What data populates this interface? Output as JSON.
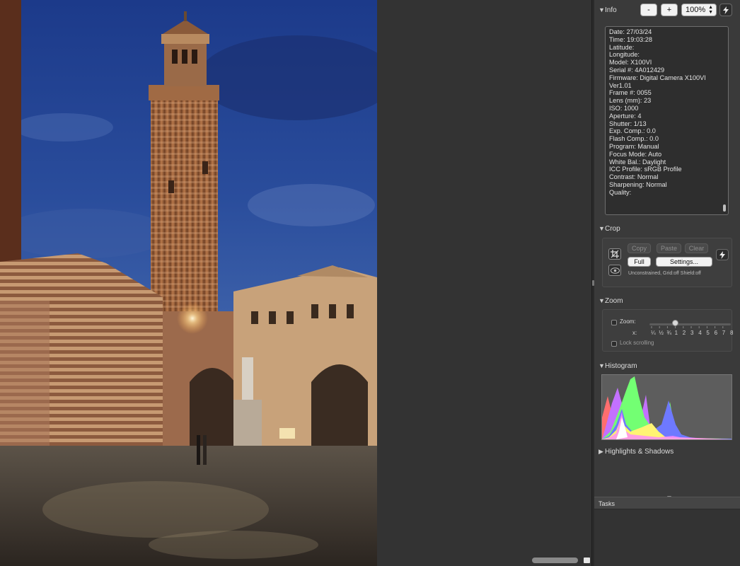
{
  "info": {
    "title": "Info",
    "zoom_out_label": "-",
    "zoom_in_label": "+",
    "zoom_level": "100%",
    "lines": [
      "Date: 27/03/24",
      "Time: 19:03:28",
      "Latitude:",
      "Longitude:",
      "Model: X100VI",
      "Serial #: 4A012429",
      "Firmware: Digital Camera X100VI",
      "Ver1.01",
      "Frame #: 0055",
      "Lens (mm): 23",
      "ISO: 1000",
      "Aperture: 4",
      "Shutter: 1/13",
      "Exp. Comp.: 0.0",
      "Flash Comp.: 0.0",
      "Program: Manual",
      "Focus Mode: Auto",
      "White Bal.: Daylight",
      "ICC Profile: sRGB Profile",
      "Contrast: Normal",
      "Sharpening: Normal",
      "Quality:"
    ]
  },
  "crop": {
    "title": "Crop",
    "copy_label": "Copy",
    "paste_label": "Paste",
    "clear_label": "Clear",
    "full_label": "Full",
    "settings_label": "Settings...",
    "status": "Unconstrained, Grid:off Shield:off"
  },
  "zoom": {
    "title": "Zoom",
    "zoom_label": "Zoom:",
    "x_label": "x:",
    "scale": [
      "¼",
      "½",
      "¾",
      "1",
      "2",
      "3",
      "4",
      "5",
      "6",
      "7",
      "8"
    ],
    "selected_index": 3,
    "lock_label": "Lock scrolling"
  },
  "histogram": {
    "title": "Histogram"
  },
  "highlights": {
    "title": "Highlights & Shadows"
  },
  "tasks": {
    "title": "Tasks"
  },
  "icons": {
    "collapse": "triangle-down-icon",
    "expand": "triangle-right-icon",
    "auto": "lightning-icon",
    "crop": "crop-icon",
    "view": "eye-icon"
  },
  "colors": {
    "panel_bg": "#3a3a3a",
    "viewer_bg": "#333333",
    "histogram_bg": "#5d5d5d"
  }
}
